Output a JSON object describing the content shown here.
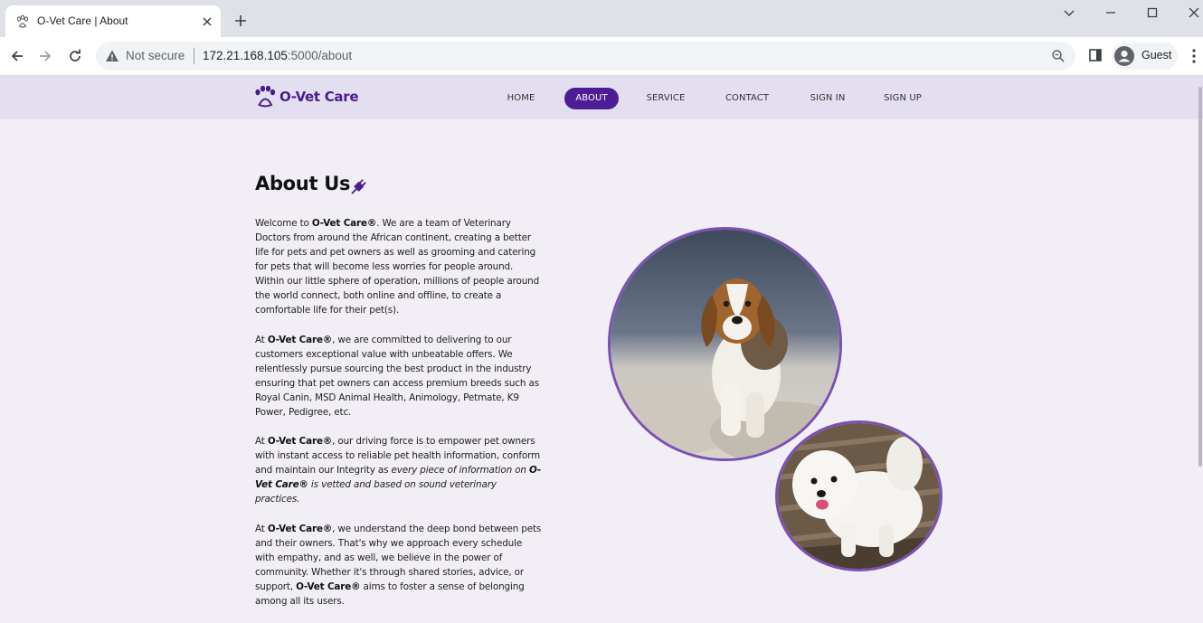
{
  "browser": {
    "tab_title": "O-Vet Care | About",
    "security_label": "Not secure",
    "url_host": "172.21.168.105",
    "url_path": ":5000/about",
    "profile_name": "Guest"
  },
  "site": {
    "brand": "O-Vet Care",
    "brand_color": "#4a1d8f",
    "accent_color": "#4c1d95",
    "nav": [
      {
        "label": "HOME"
      },
      {
        "label": "ABOUT",
        "active": true
      },
      {
        "label": "SERVICE"
      },
      {
        "label": "CONTACT"
      },
      {
        "label": "SIGN IN"
      },
      {
        "label": "SIGN UP"
      }
    ]
  },
  "about": {
    "title": "About Us",
    "title_icon": "plug-icon",
    "p1": {
      "pre": "Welcome to ",
      "brand": "O-Vet Care®",
      "post": ". We are a team of Veterinary Doctors from around the African continent, creating a better life for pets and pet owners as well as grooming and catering for pets that will become less worries for people around. Within our little sphere of operation, millions of people around the world connect, both online and offline, to create a comfortable life for their pet(s)."
    },
    "p2": {
      "pre": "At ",
      "brand": "O-Vet Care®",
      "post": ", we are committed to delivering to our customers exceptional value with unbeatable offers. We relentlessly pursue sourcing the best product in the industry ensuring that pet owners can access premium breeds such as Royal Canin, MSD Animal Health, Animology, Petmate, K9 Power, Pedigree, etc."
    },
    "p3": {
      "pre": "At ",
      "brand": "O-Vet Care®",
      "mid": ", our driving force is to empower pet owners with instant access to reliable pet health information, conform and maintain our Integrity as ",
      "italic_pre": "every piece of information on ",
      "italic_brand": "O-Vet Care®",
      "italic_post": " is vetted and based on sound veterinary practices."
    },
    "p4": {
      "pre": "At ",
      "brand": "O-Vet Care®",
      "mid": ", we understand the deep bond between pets and their owners. That's why we approach every schedule with empathy, and as well, we believe in the power of community. Whether it's through shared stories, advice, or support, ",
      "brand2": "O-Vet Care®",
      "post": " aims to foster a sense of belonging among all its users."
    }
  }
}
